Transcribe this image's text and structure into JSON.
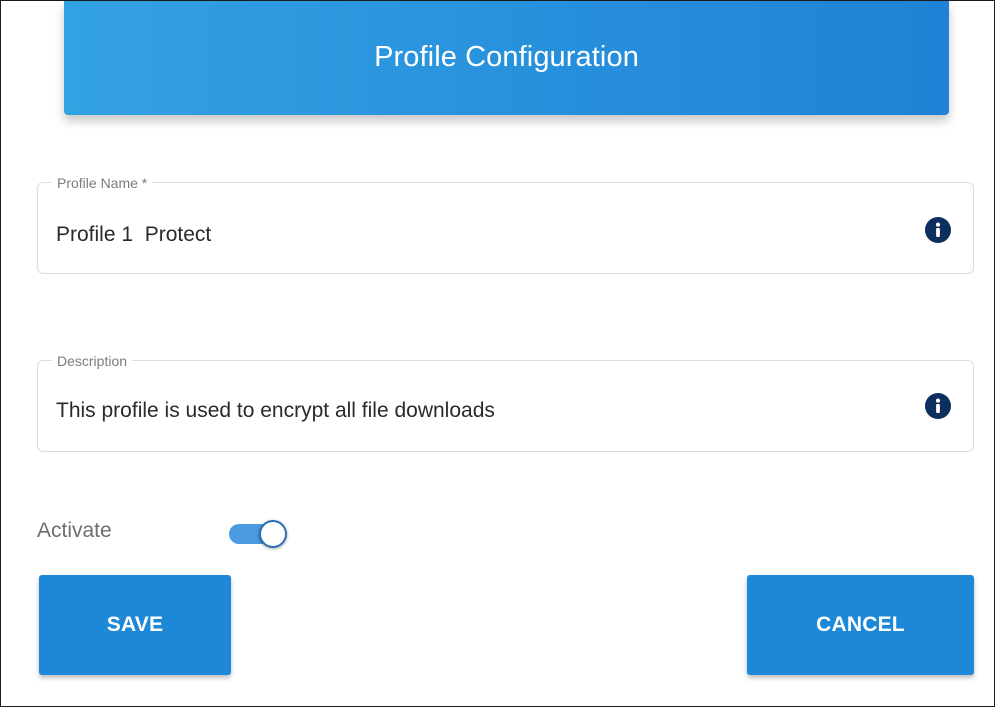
{
  "header": {
    "title": "Profile Configuration"
  },
  "form": {
    "profile_name": {
      "label": "Profile Name *",
      "value": "Profile 1  Protect",
      "icon": "info-icon"
    },
    "description": {
      "label": "Description",
      "value": "This profile is used to encrypt all file downloads",
      "icon": "info-icon"
    },
    "activate": {
      "label": "Activate",
      "state": "on"
    }
  },
  "actions": {
    "save_label": "SAVE",
    "cancel_label": "CANCEL"
  },
  "colors": {
    "header_gradient_start": "#33a2e2",
    "header_gradient_end": "#1f82d6",
    "button": "#1e88d8",
    "info_icon": "#0c2f5e",
    "toggle_track": "#4a9be0"
  }
}
